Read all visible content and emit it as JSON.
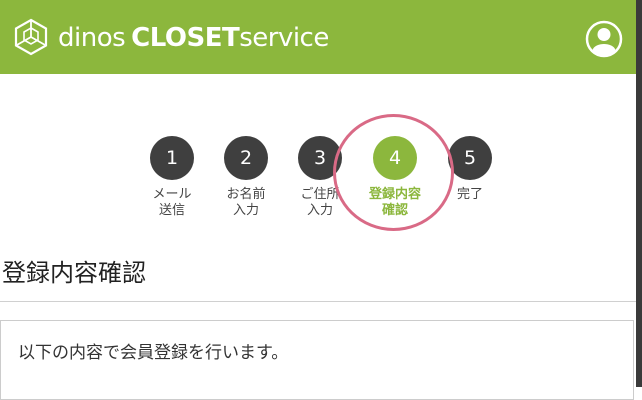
{
  "header": {
    "brand_part1": "dinos",
    "brand_part2": "CLOSET",
    "brand_part3": "service",
    "logo_icon": "cube-logo-icon",
    "account_icon": "user-account-icon",
    "background_color": "#8cb73d"
  },
  "steps": [
    {
      "number": "1",
      "label": "メール\n送信",
      "active": false
    },
    {
      "number": "2",
      "label": "お名前\n入力",
      "active": false
    },
    {
      "number": "3",
      "label": "ご住所\n入力",
      "active": false
    },
    {
      "number": "4",
      "label": "登録内容\n確認",
      "active": true
    },
    {
      "number": "5",
      "label": "完了",
      "active": false
    }
  ],
  "accent_color": "#8cb73d",
  "highlight_color": "#d96a86",
  "main": {
    "title": "登録内容確認",
    "notice": "以下の内容で会員登録を行います。"
  }
}
